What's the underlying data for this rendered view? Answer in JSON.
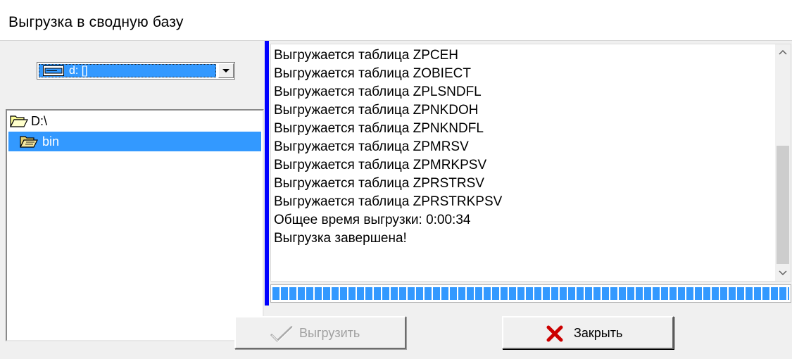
{
  "window": {
    "title": "Выгрузка в сводную базу"
  },
  "drive_combo": {
    "selected": "d: []"
  },
  "tree": {
    "items": [
      {
        "label": "D:\\",
        "icon": "folder-open-icon"
      },
      {
        "label": "bin",
        "icon": "folder-open-icon"
      }
    ]
  },
  "log": {
    "lines": [
      "Выгружается таблица ZPCEH",
      "Выгружается таблица ZOBIECT",
      "Выгружается таблица ZPLSNDFL",
      "Выгружается таблица ZPNKDOH",
      "Выгружается таблица ZPNKNDFL",
      "Выгружается таблица ZPMRSV",
      "Выгружается таблица ZPMRKPSV",
      "Выгружается таблица ZPRSTRSV",
      "Выгружается таблица ZPRSTRKPSV",
      "Общее время выгрузки: 0:00:34",
      "Выгрузка завершена!"
    ]
  },
  "progress": {
    "value": 1.0
  },
  "buttons": {
    "export_label": "Выгрузить",
    "close_label": "Закрыть"
  },
  "colors": {
    "selection": "#3399ff",
    "accent_bar": "#0000ff",
    "close_icon": "#cc0000"
  }
}
